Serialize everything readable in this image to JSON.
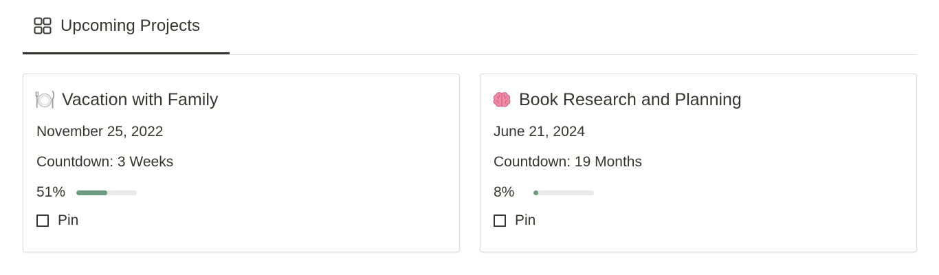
{
  "tabs": [
    {
      "label": "Upcoming Projects",
      "icon": "gallery-grid-icon",
      "active": true
    }
  ],
  "cards": [
    {
      "icon": "plate-cutlery-icon",
      "title": "Vacation with Family",
      "date": "November 25, 2022",
      "countdown": "Countdown: 3 Weeks",
      "progress_label": "51%",
      "progress": 0.51,
      "pin_label": "Pin",
      "pinned": false
    },
    {
      "icon": "brain-icon",
      "title": "Book Research and Planning",
      "date": "June 21, 2024",
      "countdown": "Countdown: 19 Months",
      "progress_label": "8%",
      "progress": 0.08,
      "pin_label": "Pin",
      "pinned": false
    }
  ],
  "colors": {
    "text": "#37352f",
    "progress_fill": "#6c9b7d",
    "progress_track": "#e9e9e7",
    "border": "#dddcd9",
    "brain": "#e87a98"
  }
}
